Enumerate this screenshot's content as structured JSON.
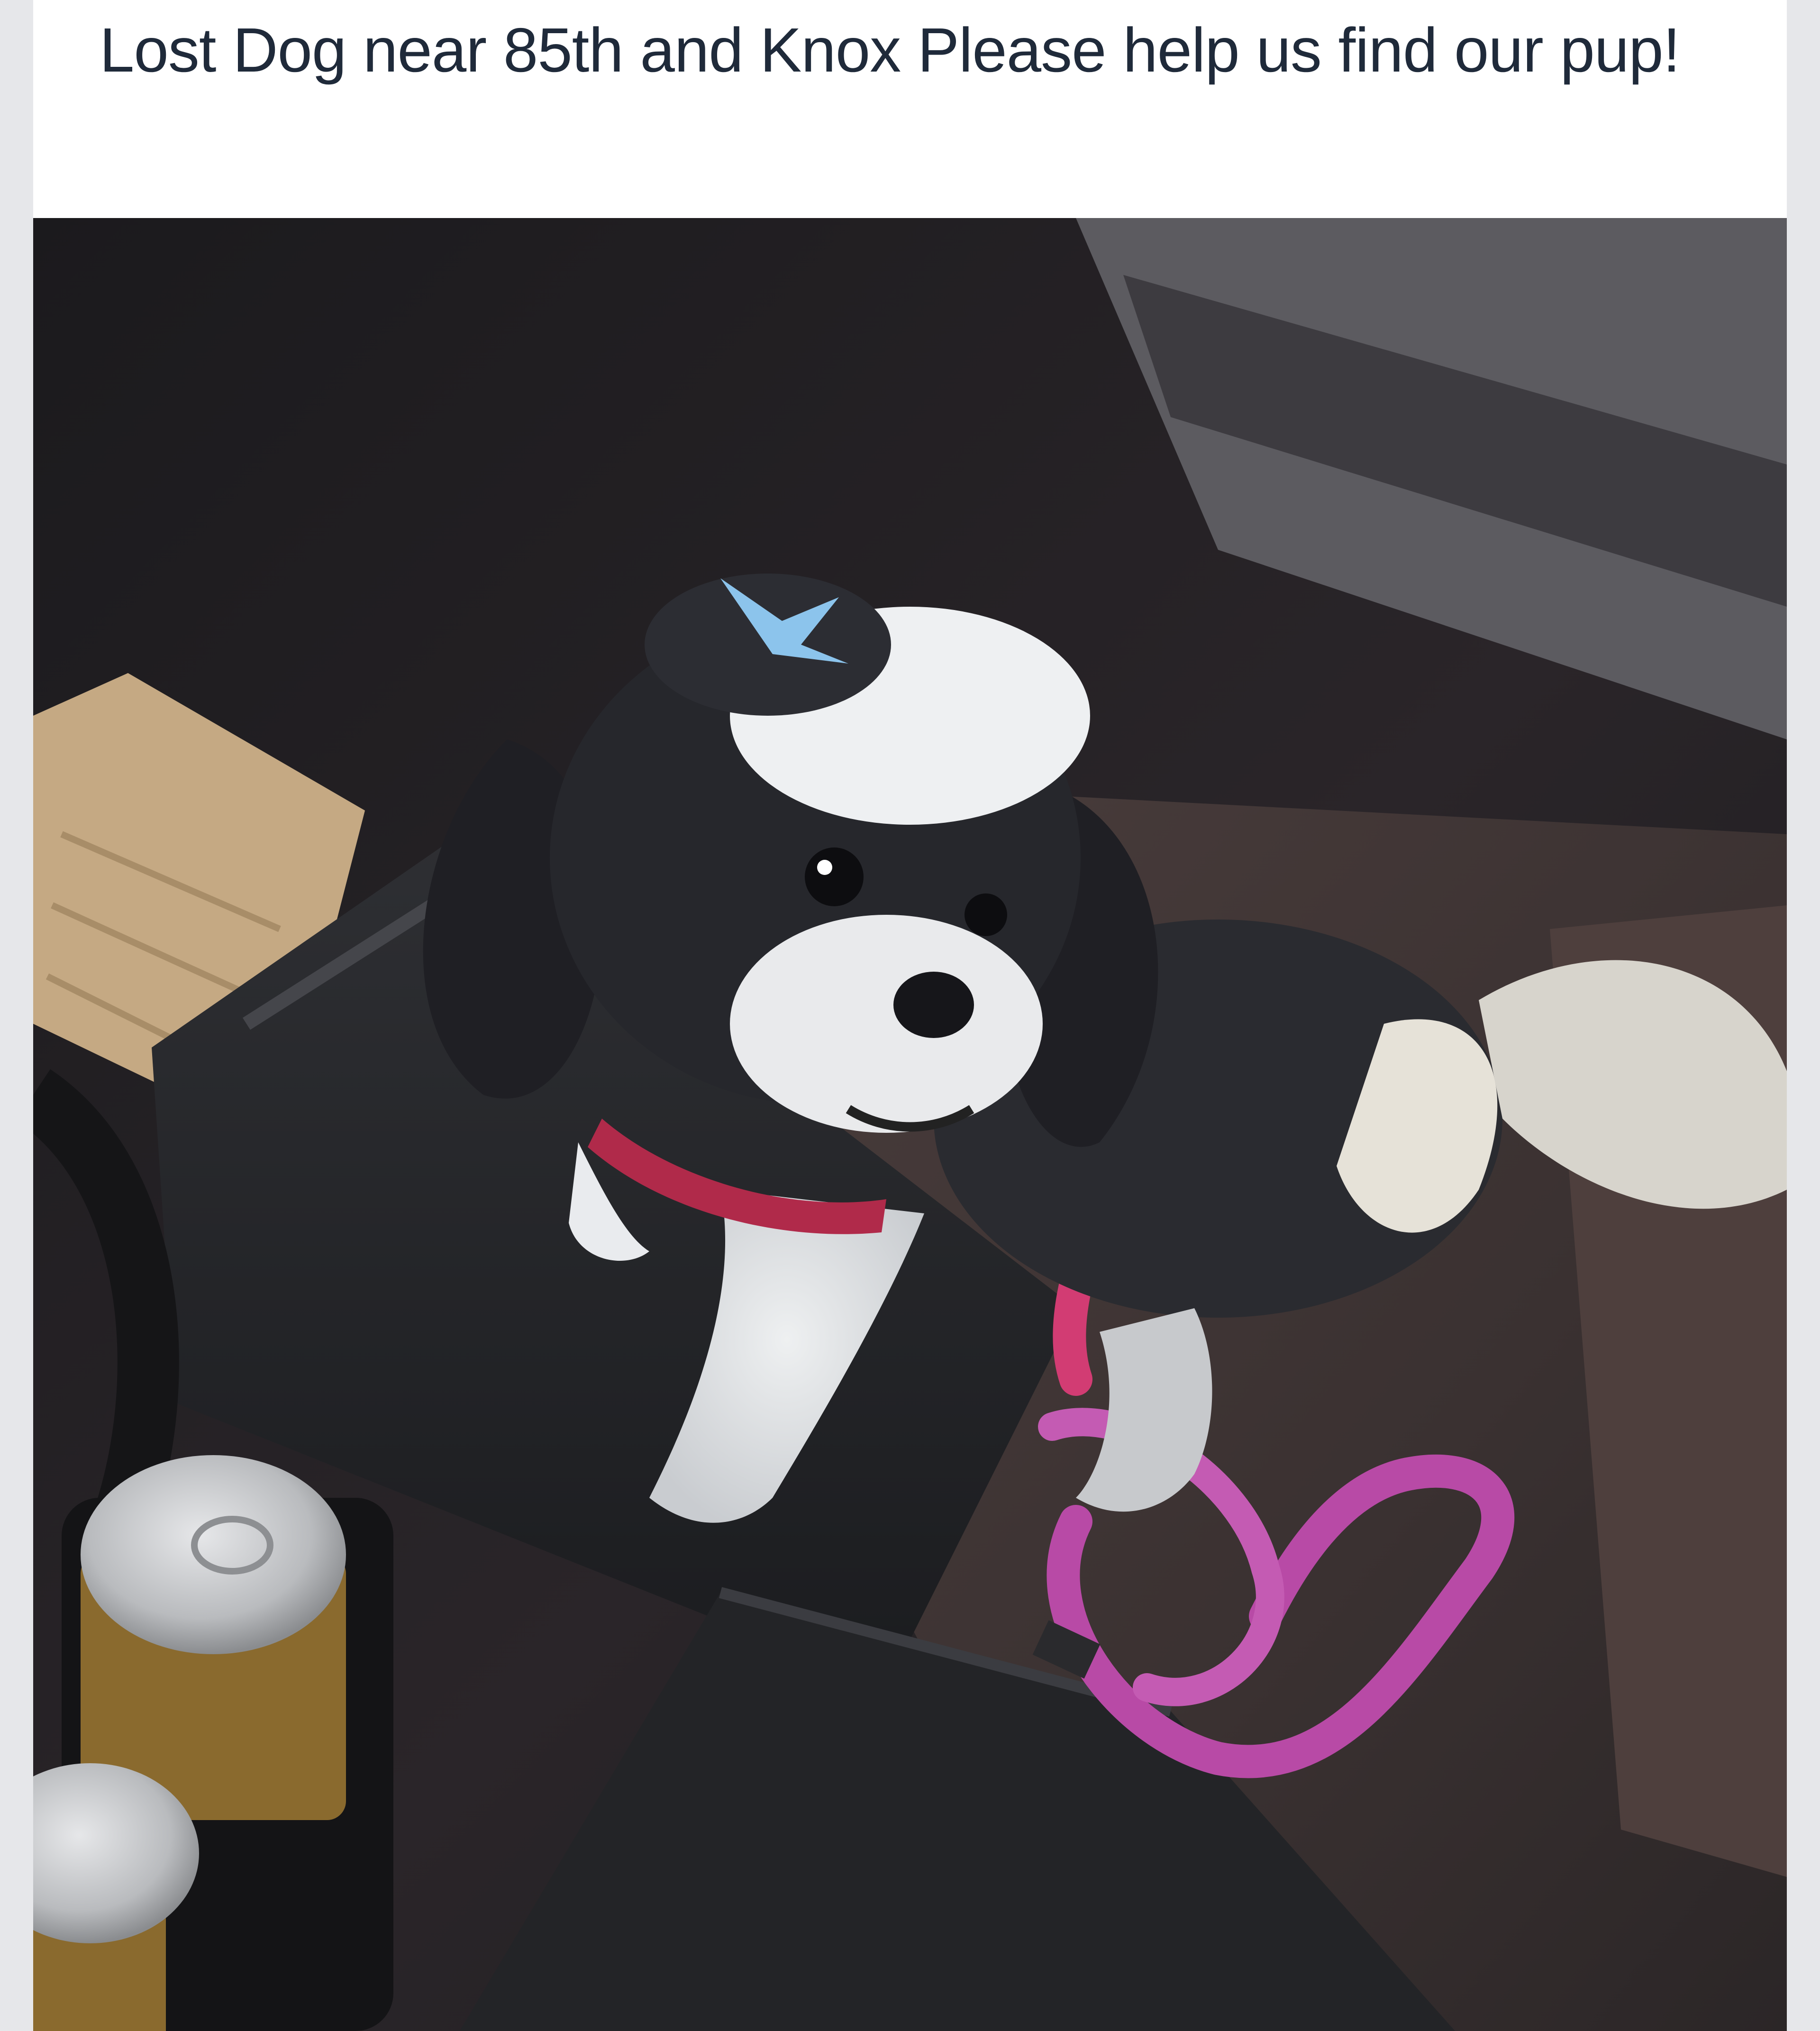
{
  "post": {
    "text": "Lost Dog near 85th and Knox Please help us find our pup!"
  },
  "photo": {
    "subject": "dog-photo"
  },
  "colors": {
    "card_background": "#ffffff",
    "page_background": "#e6e7ea",
    "text": "#1f2a3a"
  }
}
